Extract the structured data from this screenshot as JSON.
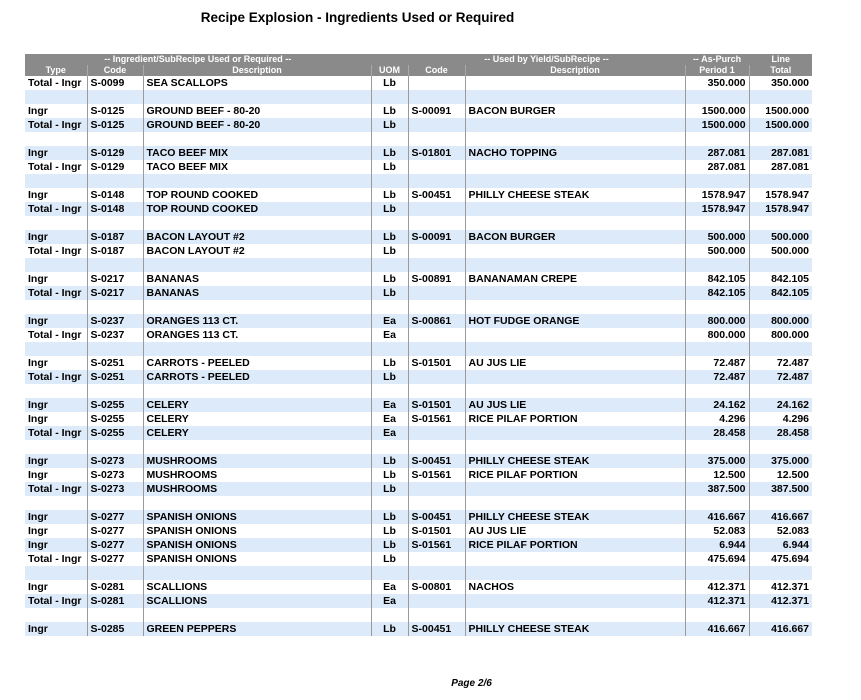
{
  "report": {
    "title": "Recipe Explosion - Ingredients Used or Required",
    "page": "Page 2/6"
  },
  "header": {
    "group_ingredient": "-- Ingredient/SubRecipe Used or Required --",
    "group_usedby": "-- Used by Yield/SubRecipe --",
    "group_aspurch": "-- As-Purch",
    "group_line": "Line",
    "col_type": "Type",
    "col_code": "Code",
    "col_description": "Description",
    "col_uom": "UOM",
    "col_used_code": "Code",
    "col_used_description": "Description",
    "col_period": "Period 1",
    "col_total": "Total"
  },
  "rows": [
    {
      "type": "Total - Ingr",
      "code": "S-0099",
      "desc": "SEA SCALLOPS",
      "uom": "Lb",
      "ucode": "",
      "udesc": "",
      "p1": "350.000",
      "total": "350.000"
    },
    {
      "type": "",
      "code": "",
      "desc": "",
      "uom": "",
      "ucode": "",
      "udesc": "",
      "p1": "",
      "total": ""
    },
    {
      "type": "Ingr",
      "code": "S-0125",
      "desc": "GROUND BEEF - 80-20",
      "uom": "Lb",
      "ucode": "S-00091",
      "udesc": "BACON BURGER",
      "p1": "1500.000",
      "total": "1500.000"
    },
    {
      "type": "Total - Ingr",
      "code": "S-0125",
      "desc": "GROUND BEEF - 80-20",
      "uom": "Lb",
      "ucode": "",
      "udesc": "",
      "p1": "1500.000",
      "total": "1500.000"
    },
    {
      "type": "",
      "code": "",
      "desc": "",
      "uom": "",
      "ucode": "",
      "udesc": "",
      "p1": "",
      "total": ""
    },
    {
      "type": "Ingr",
      "code": "S-0129",
      "desc": "TACO BEEF MIX",
      "uom": "Lb",
      "ucode": "S-01801",
      "udesc": "NACHO TOPPING",
      "p1": "287.081",
      "total": "287.081"
    },
    {
      "type": "Total - Ingr",
      "code": "S-0129",
      "desc": "TACO BEEF MIX",
      "uom": "Lb",
      "ucode": "",
      "udesc": "",
      "p1": "287.081",
      "total": "287.081"
    },
    {
      "type": "",
      "code": "",
      "desc": "",
      "uom": "",
      "ucode": "",
      "udesc": "",
      "p1": "",
      "total": ""
    },
    {
      "type": "Ingr",
      "code": "S-0148",
      "desc": "TOP ROUND COOKED",
      "uom": "Lb",
      "ucode": "S-00451",
      "udesc": "PHILLY CHEESE STEAK",
      "p1": "1578.947",
      "total": "1578.947"
    },
    {
      "type": "Total - Ingr",
      "code": "S-0148",
      "desc": "TOP ROUND COOKED",
      "uom": "Lb",
      "ucode": "",
      "udesc": "",
      "p1": "1578.947",
      "total": "1578.947"
    },
    {
      "type": "",
      "code": "",
      "desc": "",
      "uom": "",
      "ucode": "",
      "udesc": "",
      "p1": "",
      "total": ""
    },
    {
      "type": "Ingr",
      "code": "S-0187",
      "desc": "BACON LAYOUT #2",
      "uom": "Lb",
      "ucode": "S-00091",
      "udesc": "BACON BURGER",
      "p1": "500.000",
      "total": "500.000"
    },
    {
      "type": "Total - Ingr",
      "code": "S-0187",
      "desc": "BACON LAYOUT #2",
      "uom": "Lb",
      "ucode": "",
      "udesc": "",
      "p1": "500.000",
      "total": "500.000"
    },
    {
      "type": "",
      "code": "",
      "desc": "",
      "uom": "",
      "ucode": "",
      "udesc": "",
      "p1": "",
      "total": ""
    },
    {
      "type": "Ingr",
      "code": "S-0217",
      "desc": "BANANAS",
      "uom": "Lb",
      "ucode": "S-00891",
      "udesc": "BANANAMAN CREPE",
      "p1": "842.105",
      "total": "842.105"
    },
    {
      "type": "Total - Ingr",
      "code": "S-0217",
      "desc": "BANANAS",
      "uom": "Lb",
      "ucode": "",
      "udesc": "",
      "p1": "842.105",
      "total": "842.105"
    },
    {
      "type": "",
      "code": "",
      "desc": "",
      "uom": "",
      "ucode": "",
      "udesc": "",
      "p1": "",
      "total": ""
    },
    {
      "type": "Ingr",
      "code": "S-0237",
      "desc": "ORANGES 113 CT.",
      "uom": "Ea",
      "ucode": "S-00861",
      "udesc": "HOT FUDGE ORANGE",
      "p1": "800.000",
      "total": "800.000"
    },
    {
      "type": "Total - Ingr",
      "code": "S-0237",
      "desc": "ORANGES 113 CT.",
      "uom": "Ea",
      "ucode": "",
      "udesc": "",
      "p1": "800.000",
      "total": "800.000"
    },
    {
      "type": "",
      "code": "",
      "desc": "",
      "uom": "",
      "ucode": "",
      "udesc": "",
      "p1": "",
      "total": ""
    },
    {
      "type": "Ingr",
      "code": "S-0251",
      "desc": "CARROTS - PEELED",
      "uom": "Lb",
      "ucode": "S-01501",
      "udesc": "AU JUS LIE",
      "p1": "72.487",
      "total": "72.487"
    },
    {
      "type": "Total - Ingr",
      "code": "S-0251",
      "desc": "CARROTS - PEELED",
      "uom": "Lb",
      "ucode": "",
      "udesc": "",
      "p1": "72.487",
      "total": "72.487"
    },
    {
      "type": "",
      "code": "",
      "desc": "",
      "uom": "",
      "ucode": "",
      "udesc": "",
      "p1": "",
      "total": ""
    },
    {
      "type": "Ingr",
      "code": "S-0255",
      "desc": "CELERY",
      "uom": "Ea",
      "ucode": "S-01501",
      "udesc": "AU JUS LIE",
      "p1": "24.162",
      "total": "24.162"
    },
    {
      "type": "Ingr",
      "code": "S-0255",
      "desc": "CELERY",
      "uom": "Ea",
      "ucode": "S-01561",
      "udesc": "RICE PILAF PORTION",
      "p1": "4.296",
      "total": "4.296"
    },
    {
      "type": "Total - Ingr",
      "code": "S-0255",
      "desc": "CELERY",
      "uom": "Ea",
      "ucode": "",
      "udesc": "",
      "p1": "28.458",
      "total": "28.458"
    },
    {
      "type": "",
      "code": "",
      "desc": "",
      "uom": "",
      "ucode": "",
      "udesc": "",
      "p1": "",
      "total": ""
    },
    {
      "type": "Ingr",
      "code": "S-0273",
      "desc": "MUSHROOMS",
      "uom": "Lb",
      "ucode": "S-00451",
      "udesc": "PHILLY CHEESE STEAK",
      "p1": "375.000",
      "total": "375.000"
    },
    {
      "type": "Ingr",
      "code": "S-0273",
      "desc": "MUSHROOMS",
      "uom": "Lb",
      "ucode": "S-01561",
      "udesc": "RICE PILAF PORTION",
      "p1": "12.500",
      "total": "12.500"
    },
    {
      "type": "Total - Ingr",
      "code": "S-0273",
      "desc": "MUSHROOMS",
      "uom": "Lb",
      "ucode": "",
      "udesc": "",
      "p1": "387.500",
      "total": "387.500"
    },
    {
      "type": "",
      "code": "",
      "desc": "",
      "uom": "",
      "ucode": "",
      "udesc": "",
      "p1": "",
      "total": ""
    },
    {
      "type": "Ingr",
      "code": "S-0277",
      "desc": "SPANISH ONIONS",
      "uom": "Lb",
      "ucode": "S-00451",
      "udesc": "PHILLY CHEESE STEAK",
      "p1": "416.667",
      "total": "416.667"
    },
    {
      "type": "Ingr",
      "code": "S-0277",
      "desc": "SPANISH ONIONS",
      "uom": "Lb",
      "ucode": "S-01501",
      "udesc": "AU JUS LIE",
      "p1": "52.083",
      "total": "52.083"
    },
    {
      "type": "Ingr",
      "code": "S-0277",
      "desc": "SPANISH ONIONS",
      "uom": "Lb",
      "ucode": "S-01561",
      "udesc": "RICE PILAF PORTION",
      "p1": "6.944",
      "total": "6.944"
    },
    {
      "type": "Total - Ingr",
      "code": "S-0277",
      "desc": "SPANISH ONIONS",
      "uom": "Lb",
      "ucode": "",
      "udesc": "",
      "p1": "475.694",
      "total": "475.694"
    },
    {
      "type": "",
      "code": "",
      "desc": "",
      "uom": "",
      "ucode": "",
      "udesc": "",
      "p1": "",
      "total": ""
    },
    {
      "type": "Ingr",
      "code": "S-0281",
      "desc": "SCALLIONS",
      "uom": "Ea",
      "ucode": "S-00801",
      "udesc": "NACHOS",
      "p1": "412.371",
      "total": "412.371"
    },
    {
      "type": "Total - Ingr",
      "code": "S-0281",
      "desc": "SCALLIONS",
      "uom": "Ea",
      "ucode": "",
      "udesc": "",
      "p1": "412.371",
      "total": "412.371"
    },
    {
      "type": "",
      "code": "",
      "desc": "",
      "uom": "",
      "ucode": "",
      "udesc": "",
      "p1": "",
      "total": ""
    },
    {
      "type": "Ingr",
      "code": "S-0285",
      "desc": "GREEN PEPPERS",
      "uom": "Lb",
      "ucode": "S-00451",
      "udesc": "PHILLY CHEESE STEAK",
      "p1": "416.667",
      "total": "416.667"
    }
  ]
}
